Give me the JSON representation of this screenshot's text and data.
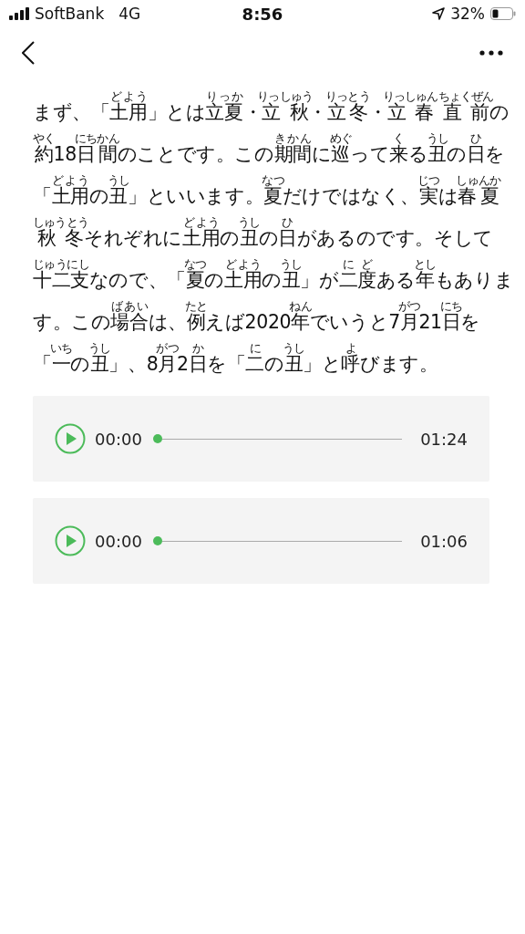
{
  "status_bar": {
    "carrier": "SoftBank",
    "network": "4G",
    "time": "8:56",
    "battery": "32%"
  },
  "article": {
    "segments": [
      {
        "text": "まず、「"
      },
      {
        "text": "土用",
        "ruby": "どよう"
      },
      {
        "text": "」とは"
      },
      {
        "text": "立夏",
        "ruby": "りっか"
      },
      {
        "text": "・"
      },
      {
        "text": "立秋",
        "ruby": "りっしゅう"
      },
      {
        "text": "・"
      },
      {
        "text": "立冬",
        "ruby": "りっとう"
      },
      {
        "text": "・"
      },
      {
        "text": "立春直前",
        "ruby": "りっしゅんちょくぜん"
      },
      {
        "text": "の"
      },
      {
        "text": "約",
        "ruby": "やく"
      },
      {
        "text": "18"
      },
      {
        "text": "日間",
        "ruby": "にちかん"
      },
      {
        "text": "のことです。この"
      },
      {
        "text": "期間",
        "ruby": "きかん"
      },
      {
        "text": "に"
      },
      {
        "text": "巡",
        "ruby": "めぐ"
      },
      {
        "text": "って"
      },
      {
        "text": "来",
        "ruby": "く"
      },
      {
        "text": "る"
      },
      {
        "text": "丑",
        "ruby": "うし"
      },
      {
        "text": "の"
      },
      {
        "text": "日",
        "ruby": "ひ"
      },
      {
        "text": "を"
      },
      {
        "text": "「"
      },
      {
        "text": "土用",
        "ruby": "どよう"
      },
      {
        "text": "の"
      },
      {
        "text": "丑",
        "ruby": "うし"
      },
      {
        "text": "」といいます。"
      },
      {
        "text": "夏",
        "ruby": "なつ"
      },
      {
        "text": "だけではなく、"
      },
      {
        "text": "実",
        "ruby": "じつ"
      },
      {
        "text": "は"
      },
      {
        "text": "春夏",
        "ruby": "しゅんか"
      },
      {
        "text": "秋冬",
        "ruby": "しゅうとう"
      },
      {
        "text": "それぞれに"
      },
      {
        "text": "土用",
        "ruby": "どよう"
      },
      {
        "text": "の"
      },
      {
        "text": "丑",
        "ruby": "うし"
      },
      {
        "text": "の"
      },
      {
        "text": "日",
        "ruby": "ひ"
      },
      {
        "text": "があるのです。そして"
      },
      {
        "text": "十二支",
        "ruby": "じゅうにし"
      },
      {
        "text": "なので、「"
      },
      {
        "text": "夏",
        "ruby": "なつ"
      },
      {
        "text": "の"
      },
      {
        "text": "土用",
        "ruby": "どよう"
      },
      {
        "text": "の"
      },
      {
        "text": "丑",
        "ruby": "うし"
      },
      {
        "text": "」が"
      },
      {
        "text": "二度",
        "ruby": "にど"
      },
      {
        "text": "ある"
      },
      {
        "text": "年",
        "ruby": "とし"
      },
      {
        "text": "もあり"
      },
      {
        "text": "ます。この"
      },
      {
        "text": "場合",
        "ruby": "ばあい"
      },
      {
        "text": "は、"
      },
      {
        "text": "例",
        "ruby": "たと"
      },
      {
        "text": "えば2020"
      },
      {
        "text": "年",
        "ruby": "ねん"
      },
      {
        "text": "でいうと7"
      },
      {
        "text": "月",
        "ruby": "がつ"
      },
      {
        "text": "21"
      },
      {
        "text": "日",
        "ruby": "にち"
      },
      {
        "text": "を"
      },
      {
        "text": "「"
      },
      {
        "text": "一",
        "ruby": "いち"
      },
      {
        "text": "の"
      },
      {
        "text": "丑",
        "ruby": "うし"
      },
      {
        "text": "」、8"
      },
      {
        "text": "月",
        "ruby": "がつ"
      },
      {
        "text": "2"
      },
      {
        "text": "日",
        "ruby": "か"
      },
      {
        "text": "を「"
      },
      {
        "text": "二",
        "ruby": "に"
      },
      {
        "text": "の"
      },
      {
        "text": "丑",
        "ruby": "うし"
      },
      {
        "text": "」と"
      },
      {
        "text": "呼",
        "ruby": "よ"
      },
      {
        "text": "びます。"
      }
    ]
  },
  "audio_players": [
    {
      "current": "00:00",
      "duration": "01:24",
      "level": 0
    },
    {
      "current": "00:00",
      "duration": "01:06",
      "level": 0
    }
  ]
}
